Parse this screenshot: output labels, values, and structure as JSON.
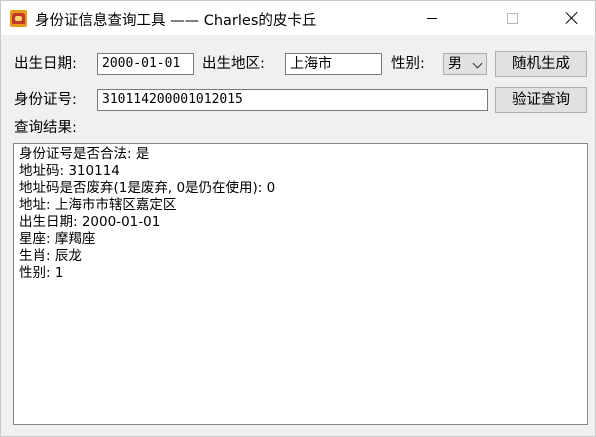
{
  "window": {
    "title": "身份证信息查询工具 —— Charles的皮卡丘"
  },
  "form": {
    "birth_date_label": "出生日期:",
    "birth_date_value": "2000-01-01",
    "birth_area_label": "出生地区:",
    "birth_area_value": "上海市",
    "gender_label": "性别:",
    "gender_selected": "男",
    "random_button": "随机生成",
    "id_label": "身份证号:",
    "id_value": "310114200001012015",
    "verify_button": "验证查询",
    "result_label": "查询结果:"
  },
  "result": {
    "lines": [
      "身份证号是否合法: 是",
      "地址码: 310114",
      "地址码是否废弃(1是废弃, 0是仍在使用): 0",
      "地址: 上海市市辖区嘉定区",
      "出生日期: 2000-01-01",
      "星座: 摩羯座",
      "生肖: 辰龙",
      "性别: 1"
    ]
  }
}
